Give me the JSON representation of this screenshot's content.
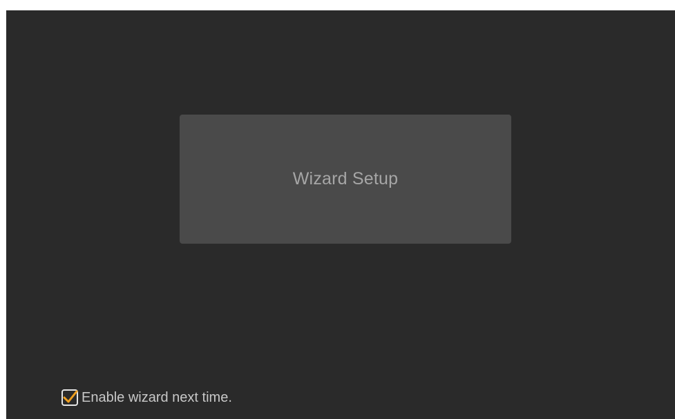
{
  "wizard": {
    "button_label": "Wizard Setup"
  },
  "enable_option": {
    "label": "Enable wizard next time.",
    "checked": true,
    "check_icon": "checkmark-icon"
  },
  "colors": {
    "background": "#2a2a2a",
    "button_fill": "#4a4a4a",
    "checkmark": "#f0a020"
  }
}
